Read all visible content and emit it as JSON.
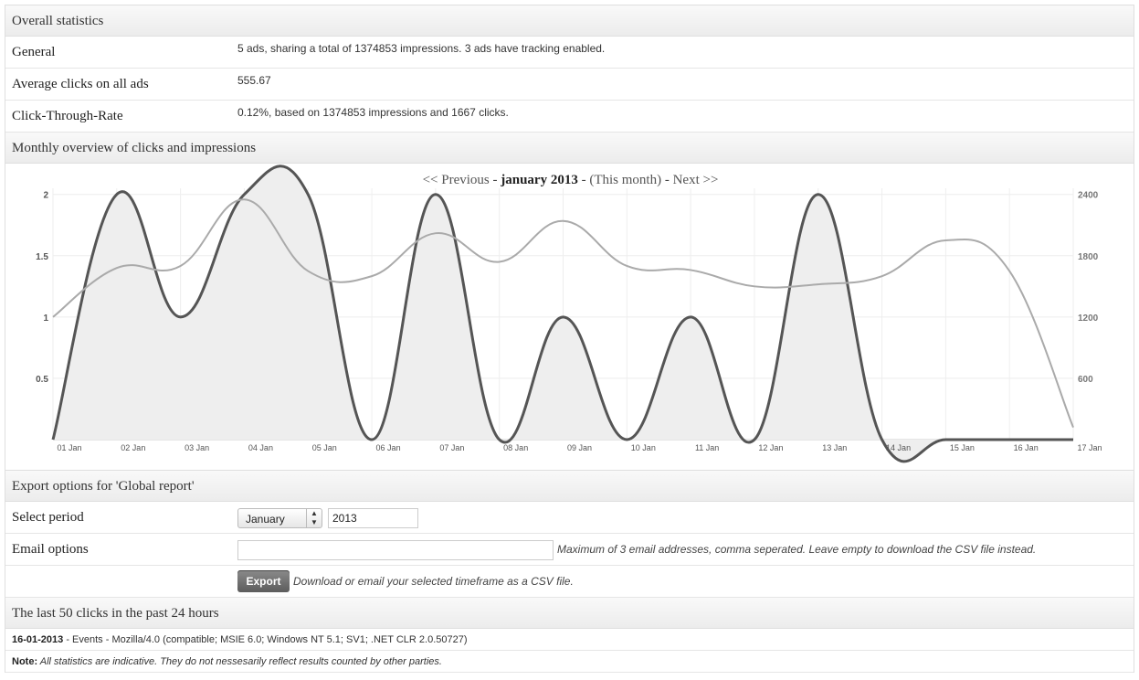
{
  "overall": {
    "header": "Overall statistics",
    "rows": [
      {
        "label": "General",
        "value": "5 ads, sharing a total of 1374853 impressions. 3 ads have tracking enabled."
      },
      {
        "label": "Average clicks on all ads",
        "value": "555.67"
      },
      {
        "label": "Click-Through-Rate",
        "value": "0.12%, based on 1374853 impressions and 1667 clicks."
      }
    ]
  },
  "monthly": {
    "header": "Monthly overview of clicks and impressions",
    "nav": {
      "previous": "<< Previous",
      "sep1": " - ",
      "current": "january 2013",
      "sep2": " - ",
      "this_month": "(This month)",
      "sep3": " - ",
      "next": "Next >>"
    }
  },
  "chart_data": {
    "type": "line",
    "categories": [
      "01 Jan",
      "02 Jan",
      "03 Jan",
      "04 Jan",
      "05 Jan",
      "06 Jan",
      "07 Jan",
      "08 Jan",
      "09 Jan",
      "10 Jan",
      "11 Jan",
      "12 Jan",
      "13 Jan",
      "14 Jan",
      "15 Jan",
      "16 Jan",
      "17 Jan"
    ],
    "series": [
      {
        "axis": "left",
        "color": "#555555",
        "filled": true,
        "values": [
          0,
          2,
          1,
          2,
          2,
          0,
          2,
          0,
          1,
          0,
          1,
          0,
          2,
          0,
          0,
          0,
          0
        ]
      },
      {
        "axis": "right",
        "color": "#aaaaaa",
        "filled": false,
        "values": [
          1200,
          1680,
          1700,
          2350,
          1650,
          1600,
          2020,
          1740,
          2140,
          1700,
          1660,
          1500,
          1520,
          1600,
          1950,
          1650,
          120
        ]
      }
    ],
    "yleft": {
      "range": [
        0,
        2.05
      ],
      "ticks": [
        "0.5",
        "1",
        "1.5",
        "2"
      ],
      "tick_values": [
        0.5,
        1,
        1.5,
        2
      ]
    },
    "yright": {
      "range": [
        0,
        2460
      ],
      "ticks": [
        "600",
        "1200",
        "1800",
        "2400"
      ],
      "tick_values": [
        600,
        1200,
        1800,
        2400
      ]
    },
    "grid": true
  },
  "export": {
    "header": "Export options for 'Global report'",
    "period_label": "Select period",
    "month_value": "January",
    "year_value": "2013",
    "email_label": "Email options",
    "email_value": "",
    "email_hint": "Maximum of 3 email addresses, comma seperated. Leave empty to download the CSV file instead.",
    "button_label": "Export",
    "button_hint": "Download or email your selected timeframe as a CSV file."
  },
  "clicks": {
    "header": "The last 50 clicks in the past 24 hours",
    "entries": [
      {
        "date": "16-01-2013",
        "text": " - Events - Mozilla/4.0 (compatible; MSIE 6.0; Windows NT 5.1; SV1; .NET CLR 2.0.50727)"
      }
    ],
    "note_label": "Note:",
    "note_text": " All statistics are indicative. They do not nessesarily reflect results counted by other parties."
  }
}
